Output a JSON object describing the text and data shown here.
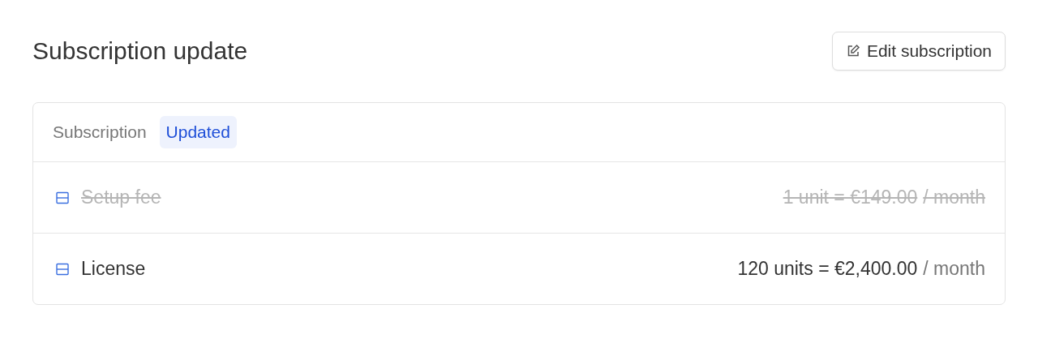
{
  "title": "Subscription update",
  "edit_button": {
    "label": "Edit subscription"
  },
  "tabs": [
    {
      "label": "Subscription",
      "selected": false
    },
    {
      "label": "Updated",
      "selected": true
    }
  ],
  "items": [
    {
      "name": "Setup fee",
      "price": "1 unit = €149.00",
      "period": "/ month",
      "removed": true
    },
    {
      "name": "License",
      "price": "120 units = €2,400.00",
      "period": "/ month",
      "removed": false
    }
  ]
}
